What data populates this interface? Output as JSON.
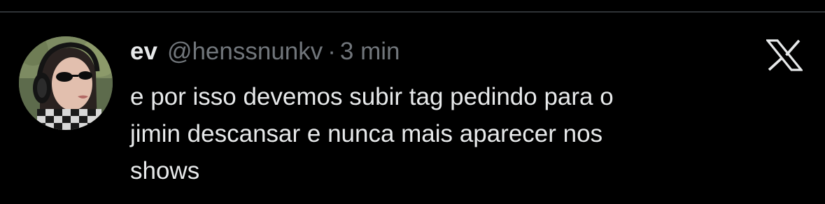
{
  "tweet": {
    "display_name": "ev",
    "handle": "@henssnunkv",
    "separator": "·",
    "time": "3 min",
    "text": "e por isso devemos subir tag pedindo para o\njimin descansar e nunca mais aparecer nos\nshows"
  },
  "icons": {
    "brand": "x-logo-icon",
    "avatar": "profile-photo"
  },
  "colors": {
    "background": "#000000",
    "primary_text": "#e7e9ea",
    "secondary_text": "#71767b",
    "divider": "#2f3336"
  }
}
